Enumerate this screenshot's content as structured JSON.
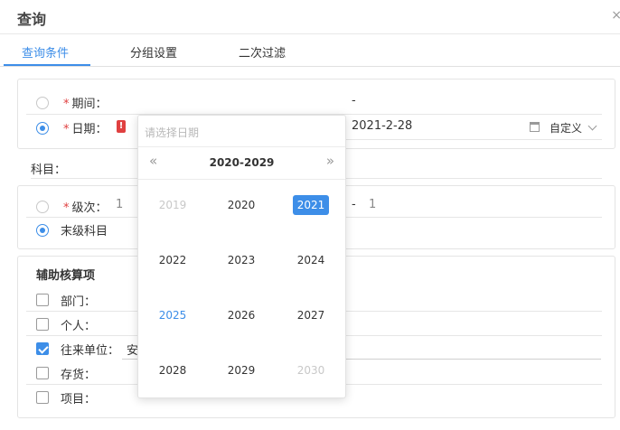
{
  "dialog": {
    "title": "查询"
  },
  "tabs": [
    {
      "label": "查询条件",
      "active": true
    },
    {
      "label": "分组设置",
      "active": false
    },
    {
      "label": "二次过滤",
      "active": false
    }
  ],
  "period": {
    "required_mark": "*",
    "period_label": "期间：",
    "period_range_sep": "-",
    "date_label": "日期：",
    "date_end": "2021-2-28",
    "date_mode": "自定义",
    "subject_label": "科目："
  },
  "level": {
    "level_label": "级次：",
    "level_from": "1",
    "level_sep": "-",
    "level_to": "1",
    "leaf_label": "末级科目"
  },
  "aux": {
    "title": "辅助核算项",
    "items": [
      {
        "label": "部门：",
        "checked": false,
        "value": ""
      },
      {
        "label": "个人：",
        "checked": false,
        "value": ""
      },
      {
        "label": "往来单位：",
        "checked": true,
        "value": "安"
      },
      {
        "label": "存货：",
        "checked": false,
        "value": ""
      },
      {
        "label": "项目：",
        "checked": false,
        "value": ""
      }
    ]
  },
  "date_picker": {
    "placeholder": "请选择日期",
    "prev": "«",
    "next": "»",
    "decade_label": "2020-2029",
    "years": [
      {
        "label": "2019",
        "state": "faded"
      },
      {
        "label": "2020",
        "state": "normal"
      },
      {
        "label": "2021",
        "state": "selected"
      },
      {
        "label": "2022",
        "state": "normal"
      },
      {
        "label": "2023",
        "state": "normal"
      },
      {
        "label": "2024",
        "state": "normal"
      },
      {
        "label": "2025",
        "state": "current"
      },
      {
        "label": "2026",
        "state": "normal"
      },
      {
        "label": "2027",
        "state": "normal"
      },
      {
        "label": "2028",
        "state": "normal"
      },
      {
        "label": "2029",
        "state": "normal"
      },
      {
        "label": "2030",
        "state": "faded"
      }
    ]
  },
  "colors": {
    "accent": "#3d8ee8",
    "required": "#e04040"
  }
}
